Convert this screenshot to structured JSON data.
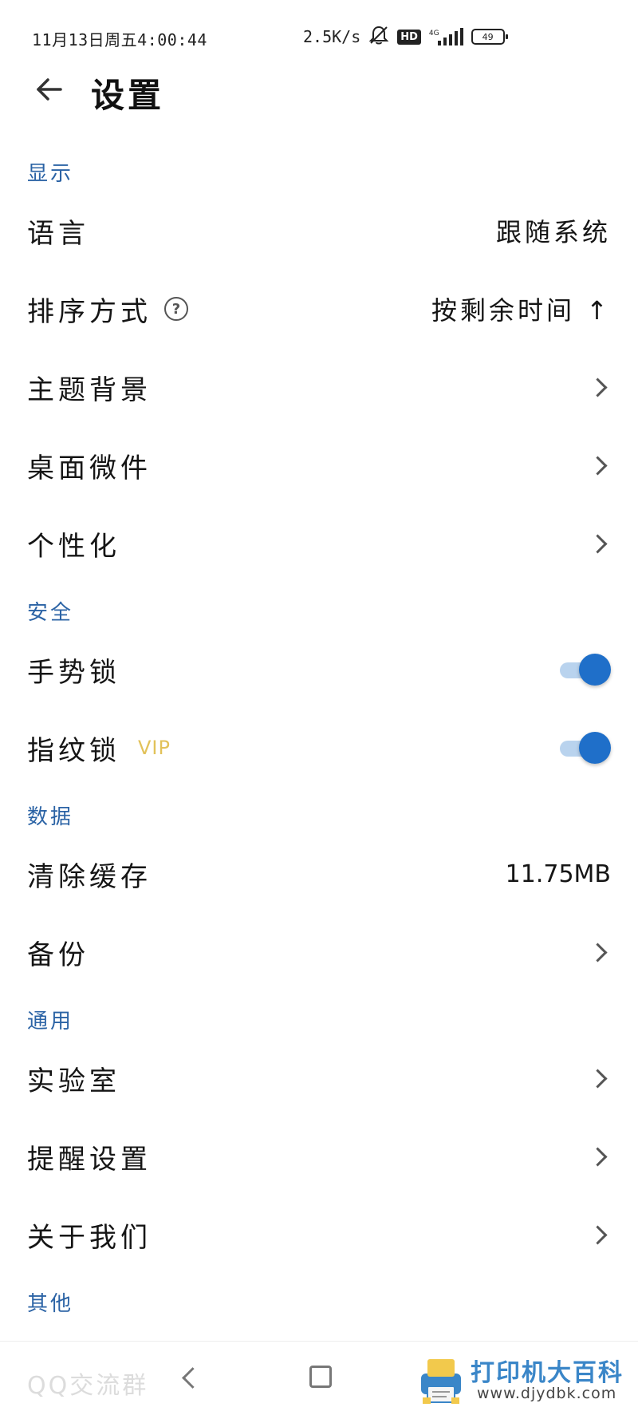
{
  "status_bar": {
    "time": "11月13日周五4:00:44",
    "net_speed": "2.5K/s",
    "hd": "HD",
    "network": "4G",
    "battery": "49"
  },
  "header": {
    "title": "设置"
  },
  "sections": {
    "display": {
      "title": "显示",
      "language": {
        "label": "语言",
        "value": "跟随系统"
      },
      "sort": {
        "label": "排序方式",
        "value": "按剩余时间 ↑"
      },
      "theme": {
        "label": "主题背景"
      },
      "widget": {
        "label": "桌面微件"
      },
      "personalize": {
        "label": "个性化"
      }
    },
    "security": {
      "title": "安全",
      "gesture_lock": {
        "label": "手势锁",
        "on": true
      },
      "fingerprint_lock": {
        "label": "指纹锁",
        "badge": "VIP",
        "on": true
      }
    },
    "data": {
      "title": "数据",
      "clear_cache": {
        "label": "清除缓存",
        "value": "11.75MB"
      },
      "backup": {
        "label": "备份"
      }
    },
    "general": {
      "title": "通用",
      "lab": {
        "label": "实验室"
      },
      "reminder": {
        "label": "提醒设置"
      },
      "about": {
        "label": "关于我们"
      }
    },
    "other": {
      "title": "其他",
      "qq_group": {
        "label": "QQ交流群"
      }
    }
  },
  "watermark": {
    "title": "打印机大百科",
    "url": "www.djydbk.com"
  },
  "colors": {
    "section_title": "#2b63a5",
    "toggle_on": "#1f6fc9",
    "toggle_track": "#b9d3ee",
    "vip": "#e2c25a"
  }
}
